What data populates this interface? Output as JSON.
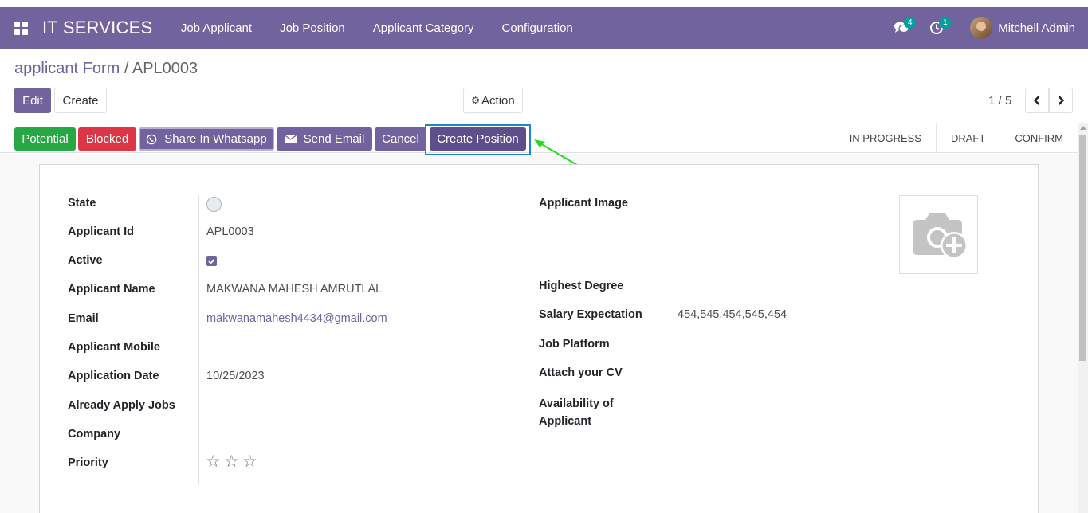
{
  "navbar": {
    "brand": "IT SERVICES",
    "menu": [
      "Job Applicant",
      "Job Position",
      "Applicant Category",
      "Configuration"
    ],
    "messages_count": "4",
    "activities_count": "1",
    "user_name": "Mitchell Admin"
  },
  "breadcrumb": {
    "parent": "applicant Form",
    "separator": "/",
    "current": "APL0003"
  },
  "toolbar": {
    "edit": "Edit",
    "create": "Create",
    "action": "Action"
  },
  "pager": {
    "value": "1 / 5"
  },
  "statusbar": {
    "buttons": [
      "Potential",
      "Blocked",
      "Share In Whatsapp",
      "Send Email",
      "Cancel",
      "Create Position"
    ],
    "stages": [
      "IN PROGRESS",
      "DRAFT",
      "CONFIRM"
    ]
  },
  "form": {
    "left": {
      "state_label": "State",
      "applicant_id_label": "Applicant Id",
      "applicant_id": "APL0003",
      "active_label": "Active",
      "active_checked": true,
      "name_label": "Applicant Name",
      "name": "MAKWANA MAHESH AMRUTLAL",
      "email_label": "Email",
      "email": "makwanamahesh4434@gmail.com",
      "mobile_label": "Applicant Mobile",
      "date_label": "Application Date",
      "date": "10/25/2023",
      "jobs_label": "Already Apply Jobs",
      "company_label": "Company",
      "priority_label": "Priority",
      "priority_stars": 0
    },
    "right": {
      "image_label": "Applicant Image",
      "degree_label": "Highest Degree",
      "salary_label": "Salary Expectation",
      "salary": "454,545,454,545,454",
      "platform_label": "Job Platform",
      "cv_label": "Attach your CV",
      "availability_label_1": "Availability of",
      "availability_label_2": "Applicant"
    }
  },
  "colors": {
    "brand": "#71639e",
    "success": "#28a745",
    "danger": "#dc3545",
    "highlight": "#1e88c7",
    "arrow": "#22dd22"
  }
}
